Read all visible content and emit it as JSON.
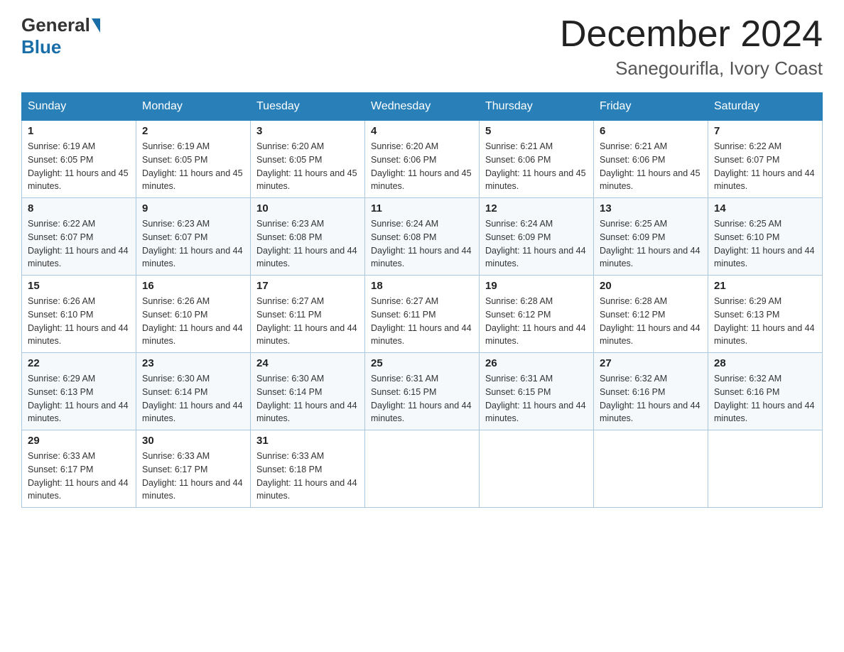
{
  "logo": {
    "general": "General",
    "blue": "Blue"
  },
  "title": {
    "month_year": "December 2024",
    "location": "Sanegourifla, Ivory Coast"
  },
  "headers": [
    "Sunday",
    "Monday",
    "Tuesday",
    "Wednesday",
    "Thursday",
    "Friday",
    "Saturday"
  ],
  "weeks": [
    [
      {
        "day": "1",
        "sunrise": "6:19 AM",
        "sunset": "6:05 PM",
        "daylight": "11 hours and 45 minutes."
      },
      {
        "day": "2",
        "sunrise": "6:19 AM",
        "sunset": "6:05 PM",
        "daylight": "11 hours and 45 minutes."
      },
      {
        "day": "3",
        "sunrise": "6:20 AM",
        "sunset": "6:05 PM",
        "daylight": "11 hours and 45 minutes."
      },
      {
        "day": "4",
        "sunrise": "6:20 AM",
        "sunset": "6:06 PM",
        "daylight": "11 hours and 45 minutes."
      },
      {
        "day": "5",
        "sunrise": "6:21 AM",
        "sunset": "6:06 PM",
        "daylight": "11 hours and 45 minutes."
      },
      {
        "day": "6",
        "sunrise": "6:21 AM",
        "sunset": "6:06 PM",
        "daylight": "11 hours and 45 minutes."
      },
      {
        "day": "7",
        "sunrise": "6:22 AM",
        "sunset": "6:07 PM",
        "daylight": "11 hours and 44 minutes."
      }
    ],
    [
      {
        "day": "8",
        "sunrise": "6:22 AM",
        "sunset": "6:07 PM",
        "daylight": "11 hours and 44 minutes."
      },
      {
        "day": "9",
        "sunrise": "6:23 AM",
        "sunset": "6:07 PM",
        "daylight": "11 hours and 44 minutes."
      },
      {
        "day": "10",
        "sunrise": "6:23 AM",
        "sunset": "6:08 PM",
        "daylight": "11 hours and 44 minutes."
      },
      {
        "day": "11",
        "sunrise": "6:24 AM",
        "sunset": "6:08 PM",
        "daylight": "11 hours and 44 minutes."
      },
      {
        "day": "12",
        "sunrise": "6:24 AM",
        "sunset": "6:09 PM",
        "daylight": "11 hours and 44 minutes."
      },
      {
        "day": "13",
        "sunrise": "6:25 AM",
        "sunset": "6:09 PM",
        "daylight": "11 hours and 44 minutes."
      },
      {
        "day": "14",
        "sunrise": "6:25 AM",
        "sunset": "6:10 PM",
        "daylight": "11 hours and 44 minutes."
      }
    ],
    [
      {
        "day": "15",
        "sunrise": "6:26 AM",
        "sunset": "6:10 PM",
        "daylight": "11 hours and 44 minutes."
      },
      {
        "day": "16",
        "sunrise": "6:26 AM",
        "sunset": "6:10 PM",
        "daylight": "11 hours and 44 minutes."
      },
      {
        "day": "17",
        "sunrise": "6:27 AM",
        "sunset": "6:11 PM",
        "daylight": "11 hours and 44 minutes."
      },
      {
        "day": "18",
        "sunrise": "6:27 AM",
        "sunset": "6:11 PM",
        "daylight": "11 hours and 44 minutes."
      },
      {
        "day": "19",
        "sunrise": "6:28 AM",
        "sunset": "6:12 PM",
        "daylight": "11 hours and 44 minutes."
      },
      {
        "day": "20",
        "sunrise": "6:28 AM",
        "sunset": "6:12 PM",
        "daylight": "11 hours and 44 minutes."
      },
      {
        "day": "21",
        "sunrise": "6:29 AM",
        "sunset": "6:13 PM",
        "daylight": "11 hours and 44 minutes."
      }
    ],
    [
      {
        "day": "22",
        "sunrise": "6:29 AM",
        "sunset": "6:13 PM",
        "daylight": "11 hours and 44 minutes."
      },
      {
        "day": "23",
        "sunrise": "6:30 AM",
        "sunset": "6:14 PM",
        "daylight": "11 hours and 44 minutes."
      },
      {
        "day": "24",
        "sunrise": "6:30 AM",
        "sunset": "6:14 PM",
        "daylight": "11 hours and 44 minutes."
      },
      {
        "day": "25",
        "sunrise": "6:31 AM",
        "sunset": "6:15 PM",
        "daylight": "11 hours and 44 minutes."
      },
      {
        "day": "26",
        "sunrise": "6:31 AM",
        "sunset": "6:15 PM",
        "daylight": "11 hours and 44 minutes."
      },
      {
        "day": "27",
        "sunrise": "6:32 AM",
        "sunset": "6:16 PM",
        "daylight": "11 hours and 44 minutes."
      },
      {
        "day": "28",
        "sunrise": "6:32 AM",
        "sunset": "6:16 PM",
        "daylight": "11 hours and 44 minutes."
      }
    ],
    [
      {
        "day": "29",
        "sunrise": "6:33 AM",
        "sunset": "6:17 PM",
        "daylight": "11 hours and 44 minutes."
      },
      {
        "day": "30",
        "sunrise": "6:33 AM",
        "sunset": "6:17 PM",
        "daylight": "11 hours and 44 minutes."
      },
      {
        "day": "31",
        "sunrise": "6:33 AM",
        "sunset": "6:18 PM",
        "daylight": "11 hours and 44 minutes."
      },
      null,
      null,
      null,
      null
    ]
  ]
}
